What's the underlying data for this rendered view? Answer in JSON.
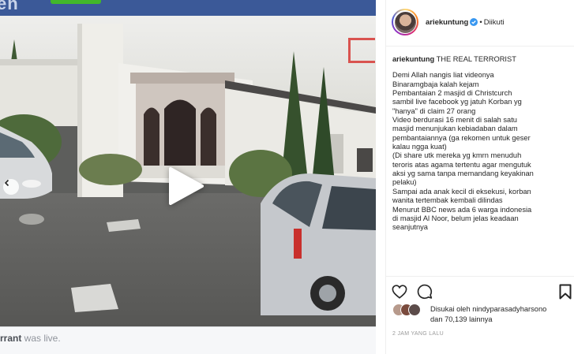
{
  "media": {
    "topbar_logo_text": "en",
    "footer_name": "rrant",
    "footer_suffix": " was live."
  },
  "post": {
    "username": "ariekuntung",
    "follow_status": "Diikuti",
    "caption": {
      "title": "THE REAL TERRORIST",
      "lines": [
        "Demi Allah nangis liat videonya",
        "Binaramgbaja kalah kejam",
        "Pembantaian 2 masjid di Christcurch",
        "sambil live facebook yg jatuh Korban yg",
        "\"hanya\" di claim 27 orang",
        "Video berdurasi 16 menit di salah satu",
        "masjid menunjukan kebiadaban dalam",
        "pembantaiannya (ga rekomen untuk geser",
        "kalau ngga kuat)",
        "(Di share utk mereka yg kmrn menuduh",
        "teroris atas agama tertentu agar mengutuk",
        "aksi yg sama tanpa memandang keyakinan",
        "pelaku)",
        "Sampai ada anak kecil di eksekusi, korban",
        "wanita tertembak kembali dilindas",
        "Menurut BBC news ada 6 warga indonesia",
        "di masjid Al Noor, belum jelas keadaan",
        "seanjutnya"
      ]
    },
    "likes": {
      "prefix": "Disukai oleh ",
      "first_liker": "nindyparasadyharsono",
      "second_line": "dan 70,139 lainnya"
    },
    "timestamp": "2 JAM YANG LALU"
  },
  "icons": {
    "verified": "verified-badge-icon",
    "like": "heart-icon",
    "comment": "comment-bubble-icon",
    "save": "bookmark-icon",
    "play": "play-icon",
    "prev": "chevron-left-icon"
  },
  "colors": {
    "verified_blue": "#3897f0",
    "text": "#262626",
    "muted": "#999999",
    "fb_blue": "#3b5998"
  }
}
